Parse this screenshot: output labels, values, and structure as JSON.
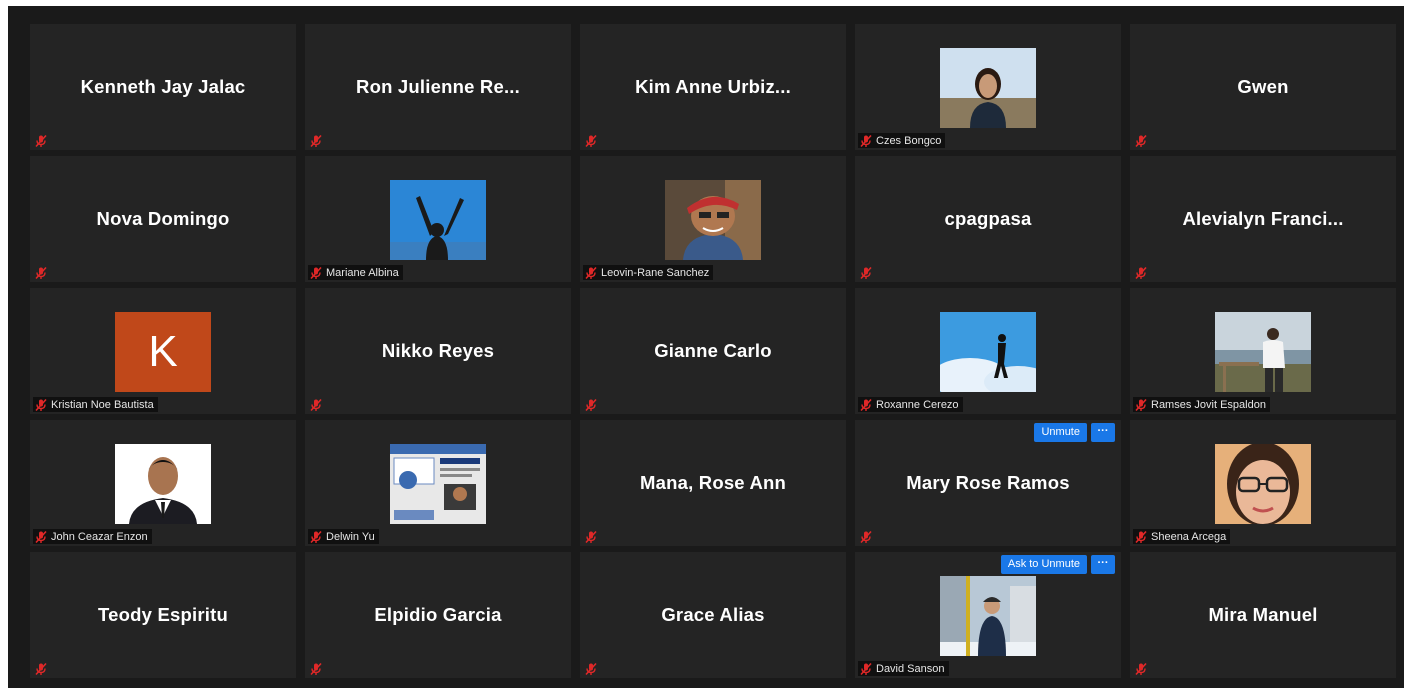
{
  "participants": [
    {
      "display_name": "Kenneth Jay Jalac",
      "tile_label": "",
      "video": null
    },
    {
      "display_name": "Ron  Julienne  Re...",
      "tile_label": "",
      "video": null
    },
    {
      "display_name": "Kim  Anne  Urbiz...",
      "tile_label": "",
      "video": null
    },
    {
      "display_name": "",
      "tile_label": "Czes Bongco",
      "video": "woman-portrait"
    },
    {
      "display_name": "Gwen",
      "tile_label": "",
      "video": null
    },
    {
      "display_name": "Nova Domingo",
      "tile_label": "",
      "video": null
    },
    {
      "display_name": "",
      "tile_label": "Mariane Albina",
      "video": "arms-raised-sky"
    },
    {
      "display_name": "",
      "tile_label": "Leovin-Rane Sanchez",
      "video": "man-cap-portrait"
    },
    {
      "display_name": "cpagpasa",
      "tile_label": "",
      "video": null
    },
    {
      "display_name": "Alevialyn  Franci...",
      "tile_label": "",
      "video": null
    },
    {
      "display_name": "",
      "tile_label": "Kristian Noe Bautista",
      "video": "initial-avatar",
      "initial": "K"
    },
    {
      "display_name": "Nikko Reyes",
      "tile_label": "",
      "video": null
    },
    {
      "display_name": "Gianne Carlo",
      "tile_label": "",
      "video": null
    },
    {
      "display_name": "",
      "tile_label": "Roxanne Cerezo",
      "video": "silhouette-clouds"
    },
    {
      "display_name": "",
      "tile_label": "Ramses Jovit Espaldon",
      "video": "man-viewpoint"
    },
    {
      "display_name": "",
      "tile_label": "John Ceazar Enzon",
      "video": "formal-portrait"
    },
    {
      "display_name": "",
      "tile_label": "Delwin Yu",
      "video": "id-card"
    },
    {
      "display_name": "Mana, Rose Ann",
      "tile_label": "",
      "video": null
    },
    {
      "display_name": "Mary Rose Ramos",
      "tile_label": "",
      "video": null,
      "action": "Unmute"
    },
    {
      "display_name": "",
      "tile_label": "Sheena Arcega",
      "video": "woman-glasses"
    },
    {
      "display_name": "Teody Espiritu",
      "tile_label": "",
      "video": null
    },
    {
      "display_name": "Elpidio Garcia",
      "tile_label": "",
      "video": null
    },
    {
      "display_name": "Grace Alias",
      "tile_label": "",
      "video": null
    },
    {
      "display_name": "",
      "tile_label": "David Sanson",
      "video": "man-winter",
      "action": "Ask to Unmute"
    },
    {
      "display_name": "Mira Manuel",
      "tile_label": "",
      "video": null
    }
  ],
  "more_button_label": "···",
  "colors": {
    "background": "#1a1a1a",
    "tile": "#242424",
    "muted_icon": "#e02828",
    "button": "#1a78e8"
  },
  "icons": {
    "mic": "muted-mic-icon",
    "more": "more-options-icon"
  }
}
